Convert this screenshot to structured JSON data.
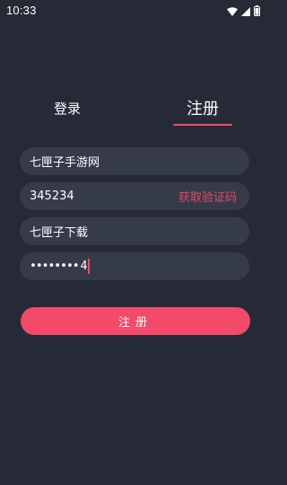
{
  "status_bar": {
    "time": "10:33",
    "icons": [
      "wifi-icon",
      "cellular-signal-icon",
      "battery-icon"
    ]
  },
  "tabs": {
    "login_label": "登录",
    "register_label": "注册",
    "active": "register"
  },
  "form": {
    "username_value": "七匣子手游网",
    "code_value": "345234",
    "get_code_label": "获取验证码",
    "nickname_value": "七匣子下载",
    "password_masked": "••••••••",
    "password_last_char": "4"
  },
  "submit_button_label": "注册",
  "colors": {
    "background": "#262a37",
    "field_background": "#363b4a",
    "accent": "#f24a68",
    "link": "#e6485f",
    "text": "#ffffff"
  }
}
